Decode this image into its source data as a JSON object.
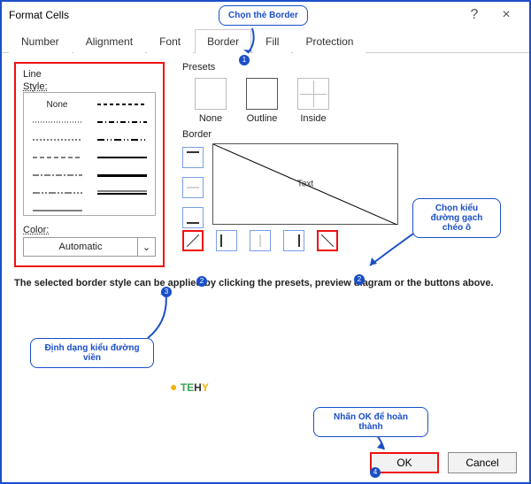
{
  "title": "Format Cells",
  "help_icon": "?",
  "close_icon": "×",
  "tabs": {
    "number": "Number",
    "alignment": "Alignment",
    "font": "Font",
    "border": "Border",
    "fill": "Fill",
    "protection": "Protection"
  },
  "line": {
    "heading": "Line",
    "style_label": "Style:",
    "none": "None",
    "color_label": "Color:",
    "color_value": "Automatic",
    "chevron": "⌄"
  },
  "presets": {
    "heading": "Presets",
    "none": "None",
    "outline": "Outline",
    "inside": "Inside"
  },
  "border_heading": "Border",
  "preview_text": "Text",
  "description": "The selected border style can be applied by clicking the presets, preview diagram or the buttons above.",
  "ok_label": "OK",
  "cancel_label": "Cancel",
  "callouts": {
    "c1": "Chọn thẻ Border",
    "c2": "Định dạng kiểu đường viền",
    "c3": "Chọn kiểu đường gạch chéo ô",
    "c4": "Nhấn OK để hoàn thành"
  },
  "markers": {
    "m1": "1",
    "m2": "2",
    "m3": "3",
    "m4": "4"
  },
  "logo": {
    "t": "TE",
    "h": "H",
    "y": "Y"
  }
}
